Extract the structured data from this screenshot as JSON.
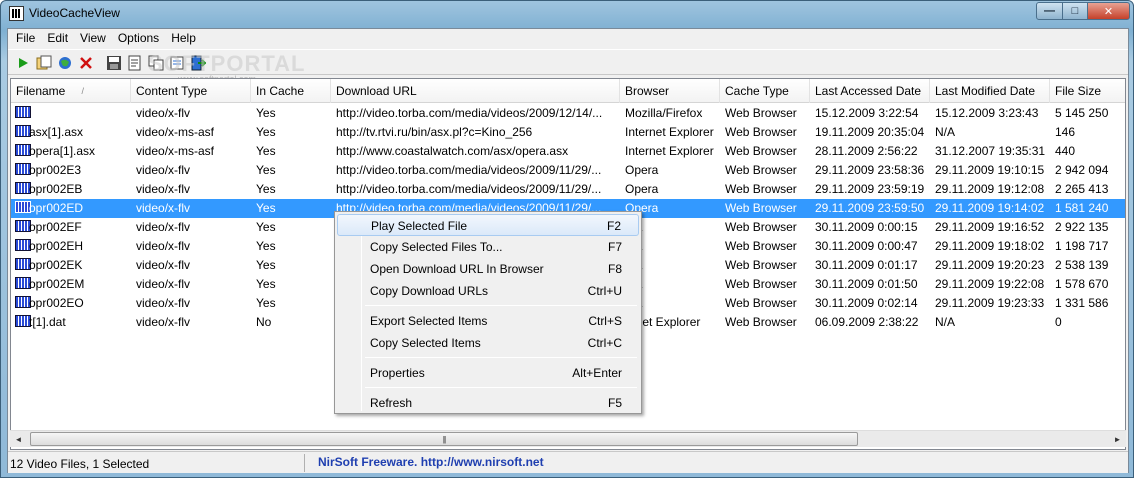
{
  "window": {
    "title": "VideoCacheView",
    "minimize_glyph": "—",
    "maximize_glyph": "□",
    "close_glyph": "✕"
  },
  "menu": [
    "File",
    "Edit",
    "View",
    "Options",
    "Help"
  ],
  "toolbar": {
    "icons": [
      "play-icon",
      "copy-files-icon",
      "open-url-icon",
      "delete-icon",
      "save-icon",
      "export-icon",
      "copy-icon",
      "properties-icon",
      "exit-icon"
    ],
    "watermark": "SOFTPORTAL",
    "watermark_sub": "www.softportal.com"
  },
  "columns": [
    "Filename",
    "Content Type",
    "In Cache",
    "Download URL",
    "Browser",
    "Cache Type",
    "Last Accessed Date",
    "Last Modified Date",
    "File Size"
  ],
  "sort_indicator": "/",
  "rows": [
    {
      "filename": "",
      "content_type": "video/x-flv",
      "in_cache": "Yes",
      "url": "http://video.torba.com/media/videos/2009/12/14/...",
      "browser": "Mozilla/Firefox",
      "cache_type": "Web Browser",
      "accessed": "15.12.2009 3:22:54",
      "modified": "15.12.2009 3:23:43",
      "size": "5 145 250"
    },
    {
      "filename": "asx[1].asx",
      "content_type": "video/x-ms-asf",
      "in_cache": "Yes",
      "url": "http://tv.rtvi.ru/bin/asx.pl?c=Kino_256",
      "browser": "Internet Explorer",
      "cache_type": "Web Browser",
      "accessed": "19.11.2009 20:35:04",
      "modified": "N/A",
      "size": "146"
    },
    {
      "filename": "opera[1].asx",
      "content_type": "video/x-ms-asf",
      "in_cache": "Yes",
      "url": "http://www.coastalwatch.com/asx/opera.asx",
      "browser": "Internet Explorer",
      "cache_type": "Web Browser",
      "accessed": "28.11.2009 2:56:22",
      "modified": "31.12.2007 19:35:31",
      "size": "440"
    },
    {
      "filename": "opr002E3",
      "content_type": "video/x-flv",
      "in_cache": "Yes",
      "url": "http://video.torba.com/media/videos/2009/11/29/...",
      "browser": "Opera",
      "cache_type": "Web Browser",
      "accessed": "29.11.2009 23:58:36",
      "modified": "29.11.2009 19:10:15",
      "size": "2 942 094"
    },
    {
      "filename": "opr002EB",
      "content_type": "video/x-flv",
      "in_cache": "Yes",
      "url": "http://video.torba.com/media/videos/2009/11/29/...",
      "browser": "Opera",
      "cache_type": "Web Browser",
      "accessed": "29.11.2009 23:59:19",
      "modified": "29.11.2009 19:12:08",
      "size": "2 265 413"
    },
    {
      "filename": "opr002ED",
      "content_type": "video/x-flv",
      "in_cache": "Yes",
      "url": "http://video.torba.com/media/videos/2009/11/29/...",
      "browser": "Opera",
      "cache_type": "Web Browser",
      "accessed": "29.11.2009 23:59:50",
      "modified": "29.11.2009 19:14:02",
      "size": "1 581 240",
      "selected": true
    },
    {
      "filename": "opr002EF",
      "content_type": "video/x-flv",
      "in_cache": "Yes",
      "url": "",
      "browser": "era",
      "cache_type": "Web Browser",
      "accessed": "30.11.2009 0:00:15",
      "modified": "29.11.2009 19:16:52",
      "size": "2 922 135"
    },
    {
      "filename": "opr002EH",
      "content_type": "video/x-flv",
      "in_cache": "Yes",
      "url": "",
      "browser": "era",
      "cache_type": "Web Browser",
      "accessed": "30.11.2009 0:00:47",
      "modified": "29.11.2009 19:18:02",
      "size": "1 198 717"
    },
    {
      "filename": "opr002EK",
      "content_type": "video/x-flv",
      "in_cache": "Yes",
      "url": "",
      "browser": "era",
      "cache_type": "Web Browser",
      "accessed": "30.11.2009 0:01:17",
      "modified": "29.11.2009 19:20:23",
      "size": "2 538 139"
    },
    {
      "filename": "opr002EM",
      "content_type": "video/x-flv",
      "in_cache": "Yes",
      "url": "",
      "browser": "era",
      "cache_type": "Web Browser",
      "accessed": "30.11.2009 0:01:50",
      "modified": "29.11.2009 19:22:08",
      "size": "1 578 670"
    },
    {
      "filename": "opr002EO",
      "content_type": "video/x-flv",
      "in_cache": "Yes",
      "url": "",
      "browser": "era",
      "cache_type": "Web Browser",
      "accessed": "30.11.2009 0:02:14",
      "modified": "29.11.2009 19:23:33",
      "size": "1 331 586"
    },
    {
      "filename": "t[1].dat",
      "content_type": "video/x-flv",
      "in_cache": "No",
      "url": "",
      "browser": "ernet Explorer",
      "cache_type": "Web Browser",
      "accessed": "06.09.2009 2:38:22",
      "modified": "N/A",
      "size": "0"
    }
  ],
  "context_menu": [
    {
      "label": "Play Selected File",
      "key": "F2",
      "hover": true
    },
    {
      "label": "Copy Selected Files To...",
      "key": "F7"
    },
    {
      "label": "Open Download URL In Browser",
      "key": "F8"
    },
    {
      "label": "Copy Download URLs",
      "key": "Ctrl+U"
    },
    {
      "separator": true
    },
    {
      "label": "Export Selected Items",
      "key": "Ctrl+S"
    },
    {
      "label": "Copy Selected Items",
      "key": "Ctrl+C"
    },
    {
      "separator": true
    },
    {
      "label": "Properties",
      "key": "Alt+Enter"
    },
    {
      "separator": true
    },
    {
      "label": "Refresh",
      "key": "F5"
    }
  ],
  "scrollbar": {
    "left_arrow": "◄",
    "right_arrow": "►",
    "grip": "|||"
  },
  "status": {
    "count_text": "12 Video Files, 1 Selected",
    "link_text": "NirSoft Freeware.  http://www.nirsoft.net"
  },
  "colors": {
    "selection": "#3399ff",
    "link": "#1f3fb0"
  }
}
